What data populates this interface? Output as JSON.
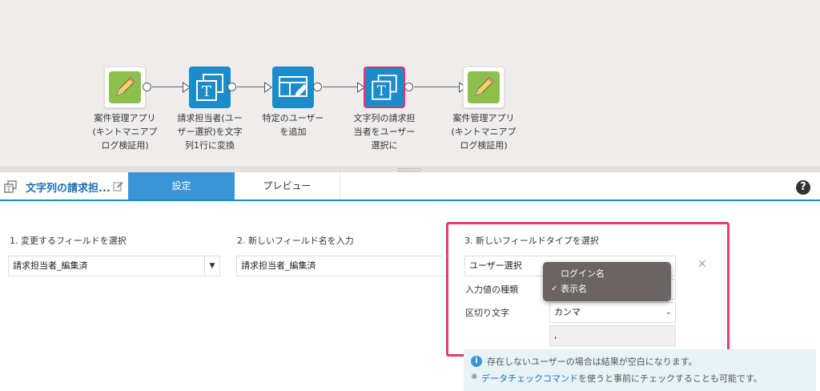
{
  "flow": {
    "nodes": [
      {
        "label": "案件管理アプリ\n(キントマニアプ\nログ検証用)",
        "icon": "pencil-app-icon"
      },
      {
        "label": "請求担当者(ユー\nザー選択)を文字\n列1行に変換",
        "icon": "text-transform-icon"
      },
      {
        "label": "特定のユーザー\nを追加",
        "icon": "table-edit-icon"
      },
      {
        "label": "文字列の請求担\n当者をユーザー\n選択に",
        "icon": "text-transform-icon"
      },
      {
        "label": "案件管理アプリ\n(キントマニアプ\nログ検証用)",
        "icon": "pencil-app-icon"
      }
    ]
  },
  "header": {
    "title": "文字列の請求担...",
    "tabs": {
      "settings": "設定",
      "preview": "プレビュー"
    },
    "help": "?"
  },
  "settings": {
    "step1": {
      "label": "1. 変更するフィールドを選択",
      "value": "請求担当者_編集済",
      "caret": "▼"
    },
    "step2": {
      "label": "2. 新しいフィールド名を入力",
      "value": "請求担当者_編集済"
    },
    "step3": {
      "label": "3. 新しいフィールドタイプを選択",
      "type_value": "ユーザー選択",
      "input_kind_label": "入力値の種類",
      "delimiter_label": "区切り文字",
      "delimiter_value": "カンマ",
      "delimiter_char": ","
    },
    "dropdown": {
      "options": [
        "ログイン名",
        "表示名"
      ],
      "selected_index": 1,
      "check": "✓"
    },
    "info": {
      "icon": "i",
      "text": "存在しないユーザーの場合は結果が空白になります。",
      "note_mark": "※",
      "link": "データチェックコマンド",
      "note_rest": "を使うと事前にチェックすることも可能です。"
    },
    "remove": "✕",
    "chevron": "⌄"
  },
  "colors": {
    "accent": "#1b8bc9",
    "highlight": "#e83a70",
    "tab_active": "#3b94d6",
    "app_green": "#8cbf4e"
  }
}
